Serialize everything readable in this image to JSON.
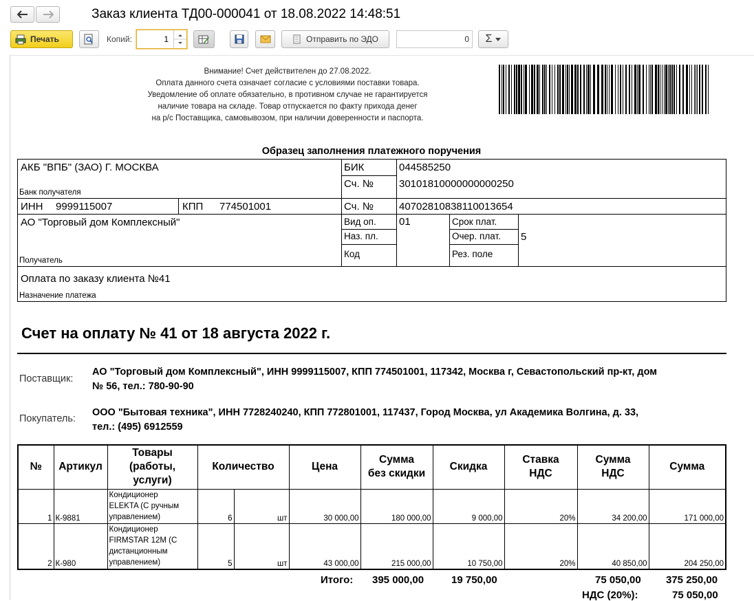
{
  "window": {
    "title": "Заказ клиента ТД00-000041 от 18.08.2022 14:48:51"
  },
  "toolbar": {
    "print_label": "Печать",
    "copies_label": "Копий:",
    "copies_value": "1",
    "send_edo_label": "Отправить по ЭДО",
    "edo_field_value": "0",
    "sum_label": "Σ"
  },
  "notice": {
    "lines": [
      "Внимание! Счет действителен до 27.08.2022.",
      "Оплата данного счета означает согласие с условиями поставки товара.",
      "Уведомление об оплате обязательно, в противном случае не гарантируется",
      "наличие товара на складе. Товар отпускается по факту прихода денег",
      "на р/с Поставщика, самовывозом, при наличии доверенности и паспорта."
    ]
  },
  "payment_order": {
    "heading": "Образец заполнения платежного поручения",
    "bank_name": "АКБ \"ВПБ\" (ЗАО) Г. МОСКВА",
    "bank_caption": "Банк получателя",
    "bik_label": "БИК",
    "bik_value": "044585250",
    "acc_label": "Сч. №",
    "corr_account": "30101810000000000250",
    "inn_label": "ИНН",
    "inn_value": "9999115007",
    "kpp_label": "КПП",
    "kpp_value": "774501001",
    "account": "40702810838110013654",
    "recipient": "АО \"Торговый дом Комплексный\"",
    "recipient_caption": "Получатель",
    "vid_op_label": "Вид оп.",
    "vid_op_value": "01",
    "naz_pl_label": "Наз. пл.",
    "kod_label": "Код",
    "srok_plat_label": "Срок плат.",
    "ocher_plat_label": "Очер. плат.",
    "ocher_plat_value": "5",
    "rez_pole_label": "Рез. поле",
    "purpose": "Оплата по заказу клиента №41",
    "purpose_caption": "Назначение платежа"
  },
  "invoice": {
    "title": "Счет на оплату № 41 от 18 августа 2022 г.",
    "supplier_label": "Поставщик:",
    "supplier_line1": "АО \"Торговый дом Комплексный\", ИНН 9999115007, КПП 774501001, 117342, Москва г, Севастопольский пр-кт, дом",
    "supplier_line2": "№ 56, тел.: 780-90-90",
    "buyer_label": "Покупатель:",
    "buyer_line1": "ООО \"Бытовая техника\", ИНН 7728240240, КПП 772801001, 117437, Город Москва, ул Академика Волгина, д. 33,",
    "buyer_line2": "тел.: (495) 6912559"
  },
  "table": {
    "headers": {
      "no": "№",
      "article": "Артикул",
      "goods_1": "Товары",
      "goods_2": "(работы,",
      "goods_3": "услуги)",
      "qty": "Количество",
      "price": "Цена",
      "sum_nodisc_1": "Сумма",
      "sum_nodisc_2": "без скидки",
      "discount": "Скидка",
      "vat_rate_1": "Ставка",
      "vat_rate_2": "НДС",
      "vat_sum_1": "Сумма",
      "vat_sum_2": "НДС",
      "sum": "Сумма"
    },
    "rows": [
      {
        "no": "1",
        "article": "К-9881",
        "name_lines": [
          "Кондиционер",
          "ELEKTA (С ручным",
          "управлением)"
        ],
        "qty": "6",
        "unit": "шт",
        "price": "30 000,00",
        "sum_nodisc": "180 000,00",
        "discount": "9 000,00",
        "vat_rate": "20%",
        "vat_sum": "34 200,00",
        "sum": "171 000,00"
      },
      {
        "no": "2",
        "article": "К-980",
        "name_lines": [
          "Кондиционер",
          "FIRMSTAR 12M (С",
          "дистанционным",
          "управлением)"
        ],
        "qty": "5",
        "unit": "шт",
        "price": "43 000,00",
        "sum_nodisc": "215 000,00",
        "discount": "10 750,00",
        "vat_rate": "20%",
        "vat_sum": "40 850,00",
        "sum": "204 250,00"
      }
    ]
  },
  "totals": {
    "total_label": "Итого:",
    "sum_nodisc": "395 000,00",
    "discount": "19 750,00",
    "vat_sum": "75 050,00",
    "sum": "375 250,00",
    "vat_label": "НДС (20%):",
    "vat_value": "75 050,00"
  }
}
